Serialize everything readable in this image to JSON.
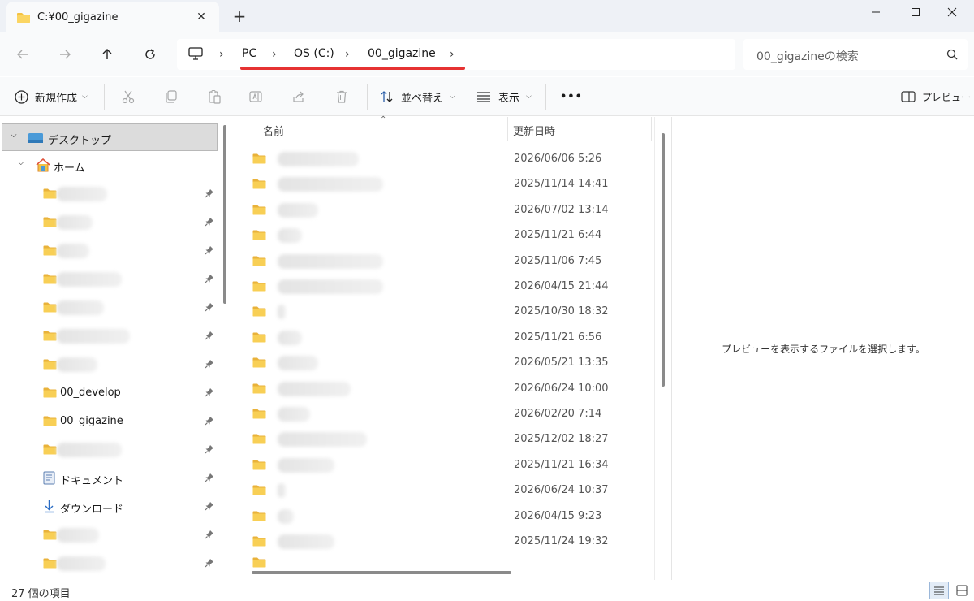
{
  "window": {
    "tab_title": "C:¥00_gigazine",
    "new_tab_symbol": "+"
  },
  "address": {
    "breadcrumbs": [
      "PC",
      "OS (C:)",
      "00_gigazine"
    ],
    "search_placeholder": "00_gigazineの検索"
  },
  "commands": {
    "new": "新規作成",
    "sort": "並べ替え",
    "view": "表示",
    "more": "•••",
    "preview": "プレビュー"
  },
  "sidebar": {
    "desktop": "デスクトップ",
    "home": "ホーム",
    "items": [
      {
        "label": "",
        "pinned": true
      },
      {
        "label": "",
        "pinned": true
      },
      {
        "label": "",
        "pinned": true
      },
      {
        "label": "",
        "pinned": true
      },
      {
        "label": "",
        "pinned": true
      },
      {
        "label": "",
        "pinned": true
      },
      {
        "label": "",
        "pinned": true
      },
      {
        "label": "00_develop",
        "pinned": true
      },
      {
        "label": "00_gigazine",
        "pinned": true
      },
      {
        "label": "",
        "pinned": true
      },
      {
        "label": "ドキュメント",
        "pinned": true,
        "icon": "document-icon"
      },
      {
        "label": "ダウンロード",
        "pinned": true,
        "icon": "download-icon"
      },
      {
        "label": "",
        "pinned": true
      },
      {
        "label": "",
        "pinned": true
      }
    ]
  },
  "file_list": {
    "columns": {
      "name": "名前",
      "date": "更新日時"
    },
    "rows": [
      {
        "name": "",
        "date": "2026/06/06 5:26"
      },
      {
        "name": "",
        "date": "2025/11/14 14:41"
      },
      {
        "name": "",
        "date": "2026/07/02 13:14"
      },
      {
        "name": "",
        "date": "2025/11/21 6:44"
      },
      {
        "name": "",
        "date": "2025/11/06 7:45"
      },
      {
        "name": "",
        "date": "2026/04/15 21:44"
      },
      {
        "name": "",
        "date": "2025/10/30 18:32"
      },
      {
        "name": "",
        "date": "2025/11/21 6:56"
      },
      {
        "name": "",
        "date": "2026/05/21 13:35"
      },
      {
        "name": "",
        "date": "2026/06/24 10:00"
      },
      {
        "name": "",
        "date": "2026/02/20 7:14"
      },
      {
        "name": "",
        "date": "2025/12/02 18:27"
      },
      {
        "name": "",
        "date": "2025/11/21 16:34"
      },
      {
        "name": "",
        "date": "2026/06/24 10:37"
      },
      {
        "name": "",
        "date": "2026/04/15 9:23"
      },
      {
        "name": "",
        "date": "2025/11/24 19:32"
      }
    ]
  },
  "preview_pane": {
    "message": "プレビューを表示するファイルを選択します。"
  },
  "status": {
    "item_count": "27 個の項目"
  },
  "colors": {
    "folder": "#f4c242",
    "highlight_underline": "#e63232",
    "selected_bg": "#dcdcdc"
  }
}
